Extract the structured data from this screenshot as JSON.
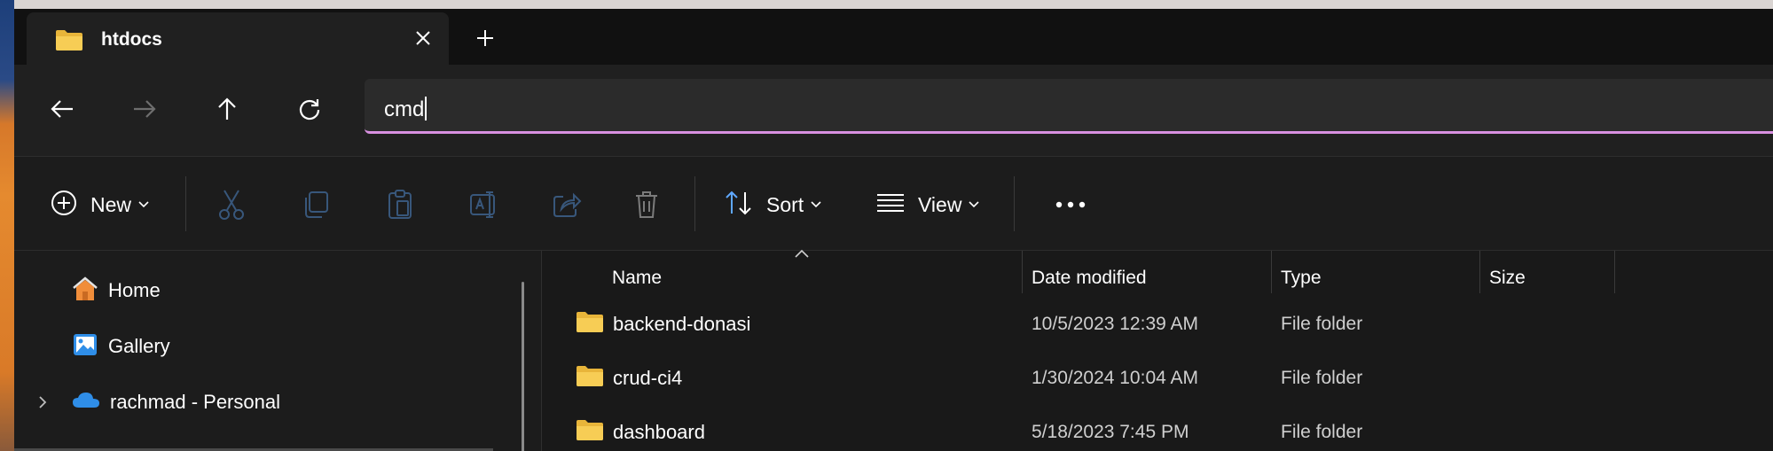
{
  "tab": {
    "title": "htdocs"
  },
  "address": {
    "value": "cmd"
  },
  "commands": {
    "new_label": "New",
    "sort_label": "Sort",
    "view_label": "View"
  },
  "nav_pane": {
    "items": [
      {
        "label": "Home",
        "icon": "home-icon"
      },
      {
        "label": "Gallery",
        "icon": "gallery-icon"
      },
      {
        "label": "rachmad - Personal",
        "icon": "onedrive-cloud-icon"
      }
    ]
  },
  "file_list": {
    "columns": [
      "Name",
      "Date modified",
      "Type",
      "Size"
    ],
    "rows": [
      {
        "name": "backend-donasi",
        "date": "10/5/2023 12:39 AM",
        "type": "File folder",
        "size": ""
      },
      {
        "name": "crud-ci4",
        "date": "1/30/2024 10:04 AM",
        "type": "File folder",
        "size": ""
      },
      {
        "name": "dashboard",
        "date": "5/18/2023 7:45 PM",
        "type": "File folder",
        "size": ""
      }
    ]
  },
  "colors": {
    "accent_underline": "#d890e0",
    "folder_yellow": "#f3c64a",
    "onedrive_blue": "#2f8ee8"
  }
}
